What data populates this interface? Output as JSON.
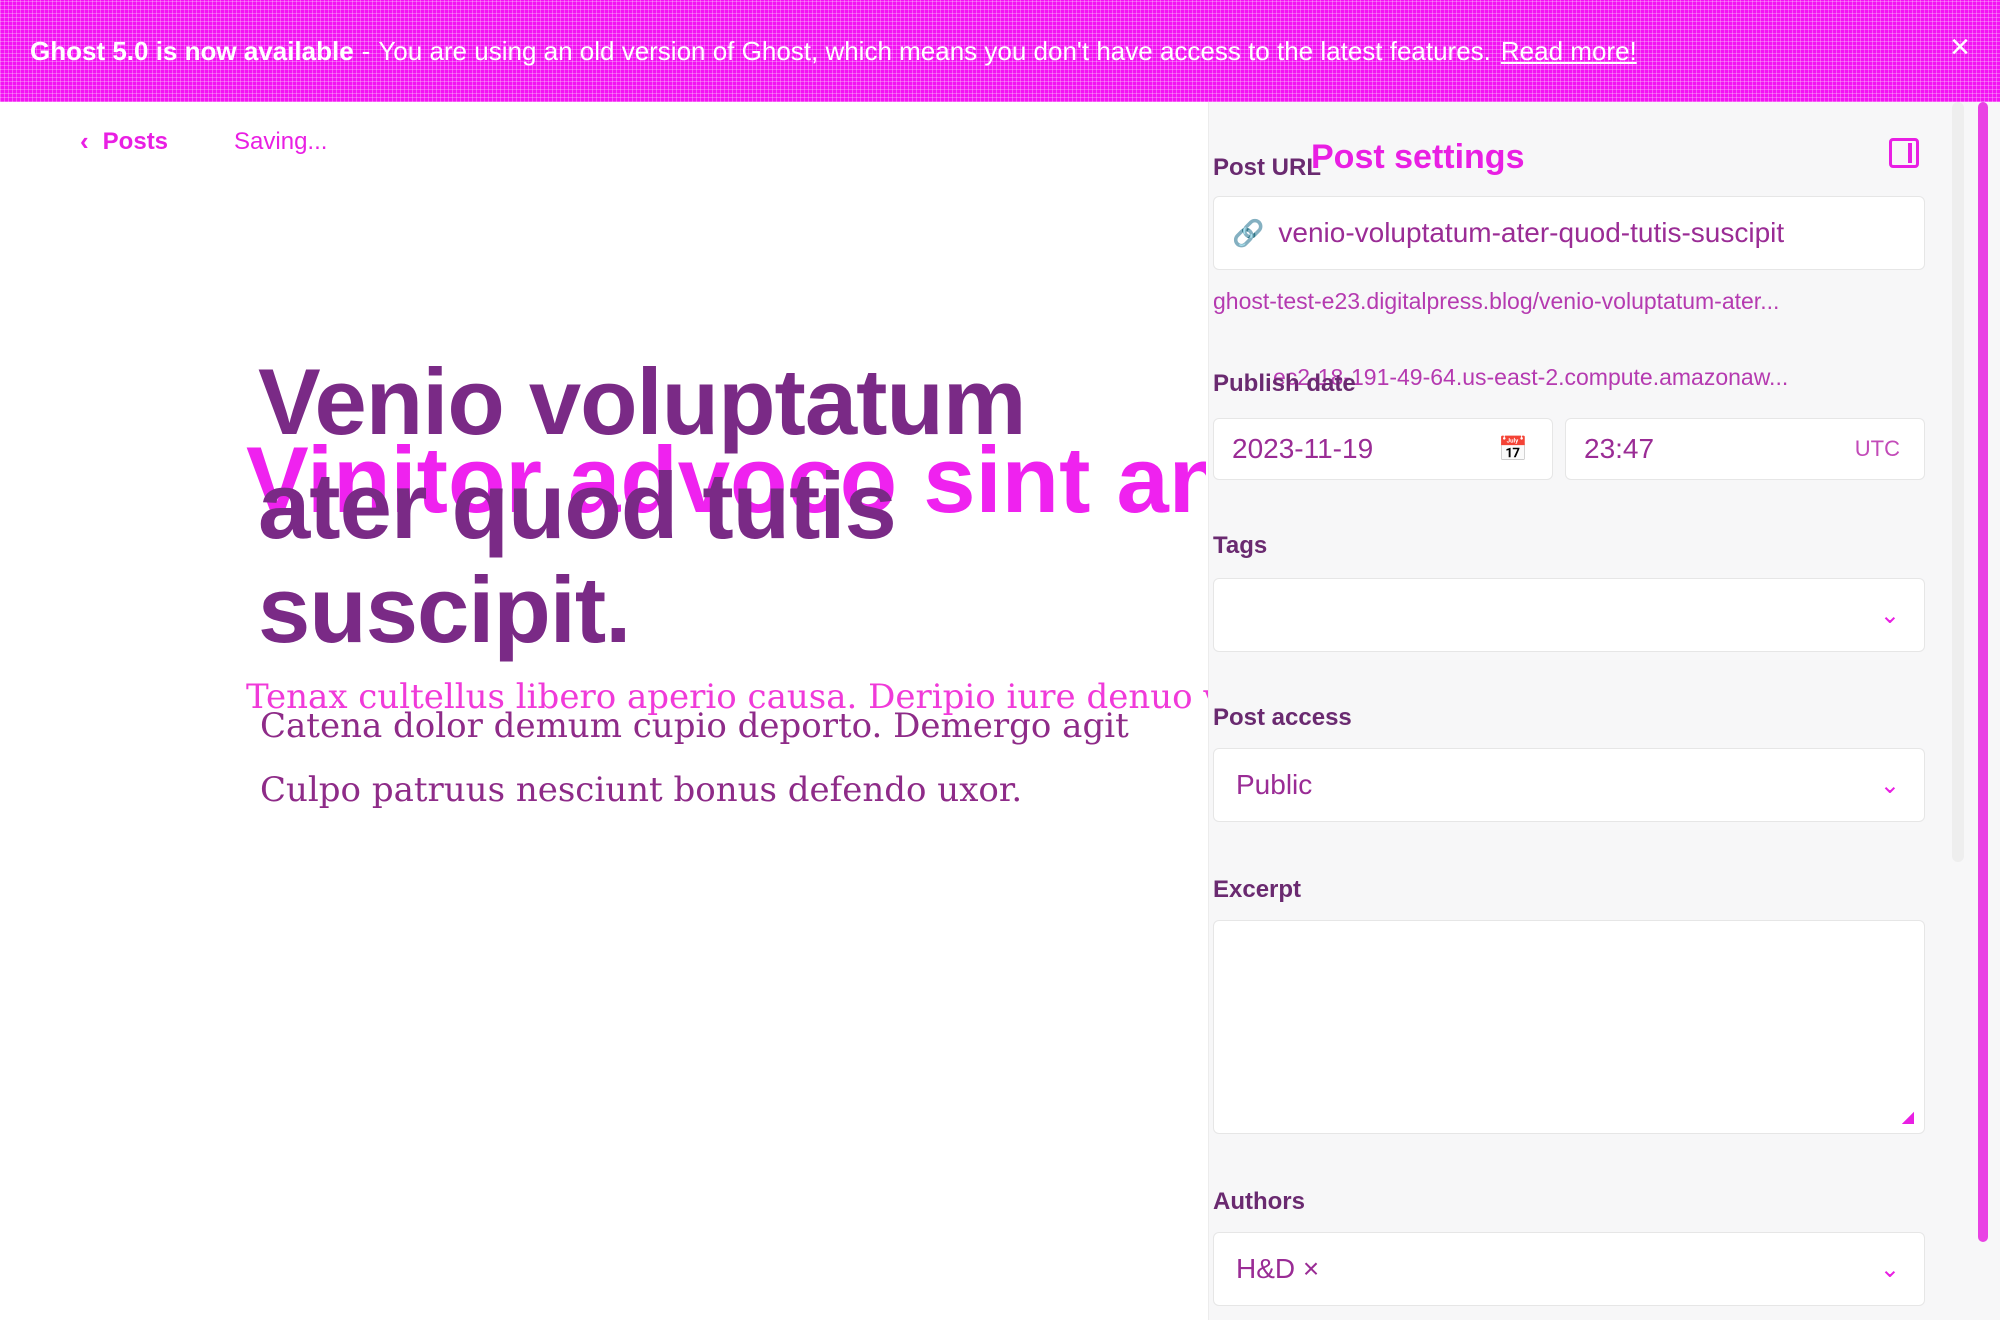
{
  "banner": {
    "headline": "Ghost 5.0 is now available",
    "separator": "-",
    "message": "You are using an old version of Ghost, which means you don't have access to the latest features.",
    "link": "Read more!",
    "close": "×"
  },
  "editor": {
    "back_label": "Posts",
    "status": "Saving...",
    "title": "Venio voluptatum ater quod tutis suscipit.",
    "title_ghost": "Vinitor advoco sint animi",
    "body_ghost": "Tenax cultellus libero aperio causa. Deripio iure denuo velociter.",
    "body_lines": [
      "Catena dolor demum cupio deporto. Demergo agit",
      "Culpo patruus nesciunt bonus defendo uxor."
    ]
  },
  "settings": {
    "title": "Post settings",
    "post_url_label": "Post URL",
    "post_url_value": "venio-voluptatum-ater-quod-tutis-suscipit",
    "post_url_hint": "ghost-test-e23.digitalpress.blog/venio-voluptatum-ater...",
    "post_url_hint2": "ec2-18-191-49-64.us-east-2.compute.amazonaw...",
    "publish_date_label": "Publish date",
    "date_value": "2023-11-19",
    "time_value": "23:47",
    "timezone": "UTC",
    "tags_label": "Tags",
    "access_label": "Post access",
    "access_value": "Public",
    "excerpt_label": "Excerpt",
    "authors_label": "Authors",
    "author_value": "H&D ×"
  },
  "icons": {
    "link": "🔗",
    "calendar": "📅",
    "chevron": "⌄",
    "back": "‹"
  },
  "colors": {
    "accent": "#e91fe3",
    "banner": "#f313f3"
  }
}
